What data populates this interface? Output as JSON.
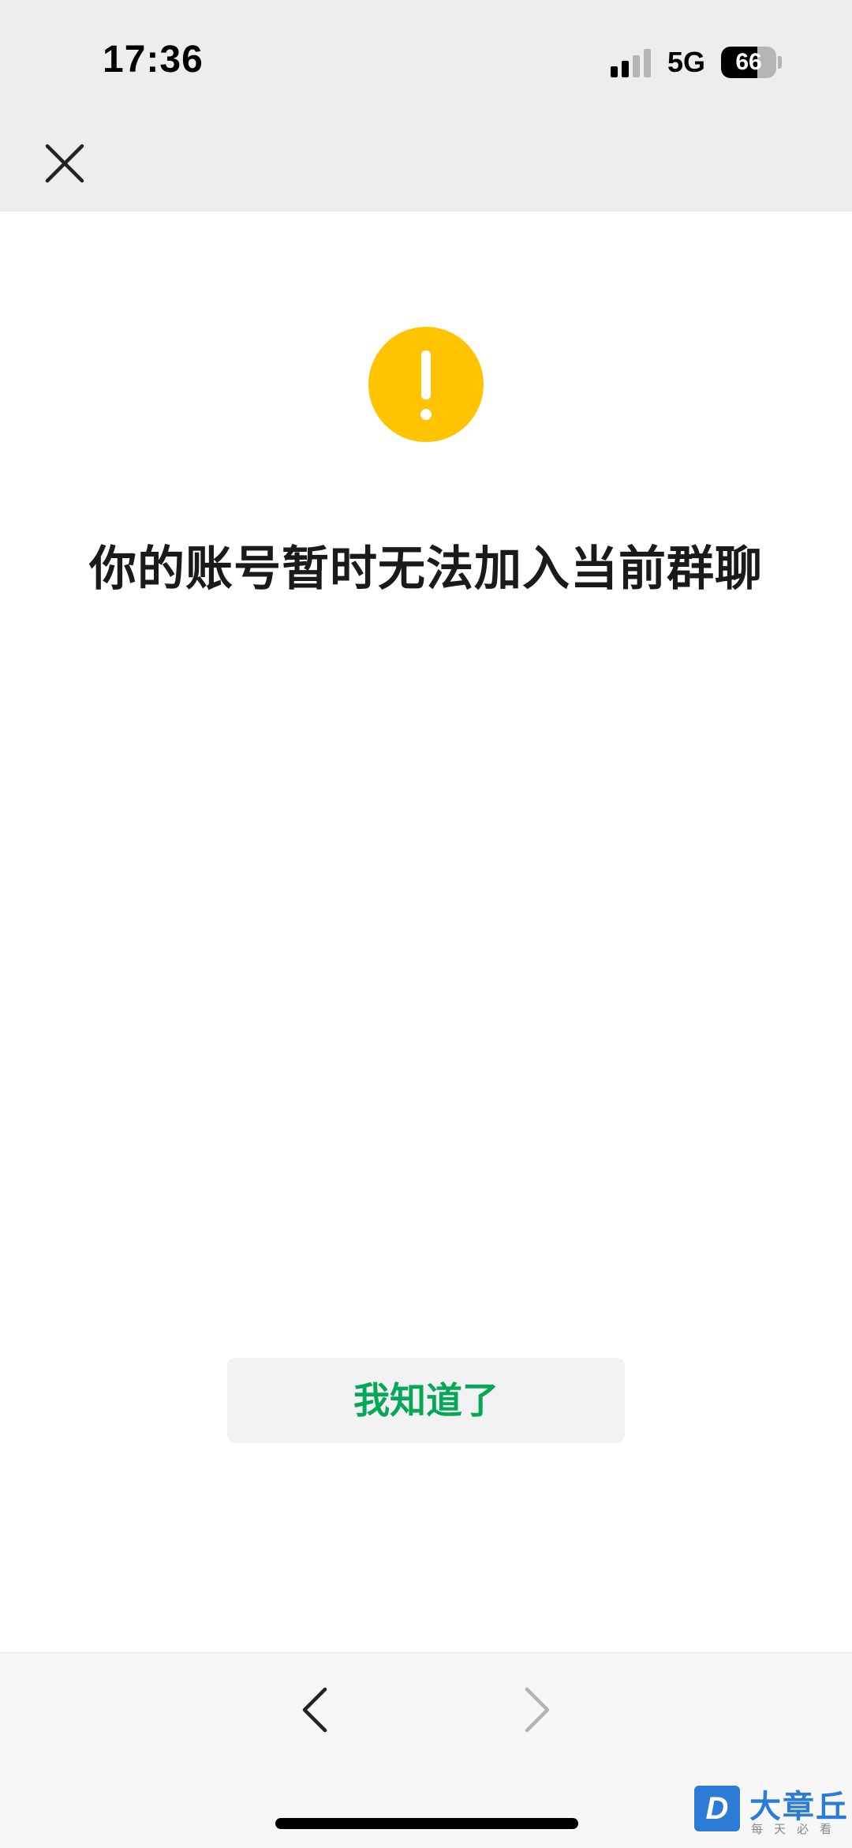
{
  "status_bar": {
    "time": "17:36",
    "network": "5G",
    "battery_percent": "66",
    "battery_level": 0.66,
    "signal_bars_active": 2,
    "signal_bars_total": 4
  },
  "header": {
    "close_icon": "close-icon"
  },
  "main": {
    "icon": "warning-exclamation-icon",
    "icon_color": "#FFC300",
    "message": "你的账号暂时无法加入当前群聊",
    "button_label": "我知道了",
    "button_text_color": "#07A758"
  },
  "toolbar": {
    "back_icon": "chevron-left-icon",
    "forward_icon": "chevron-right-icon",
    "forward_enabled": false
  },
  "watermark": {
    "logo_letter": "D",
    "title": "大章丘",
    "subtitle": "每天必看"
  }
}
